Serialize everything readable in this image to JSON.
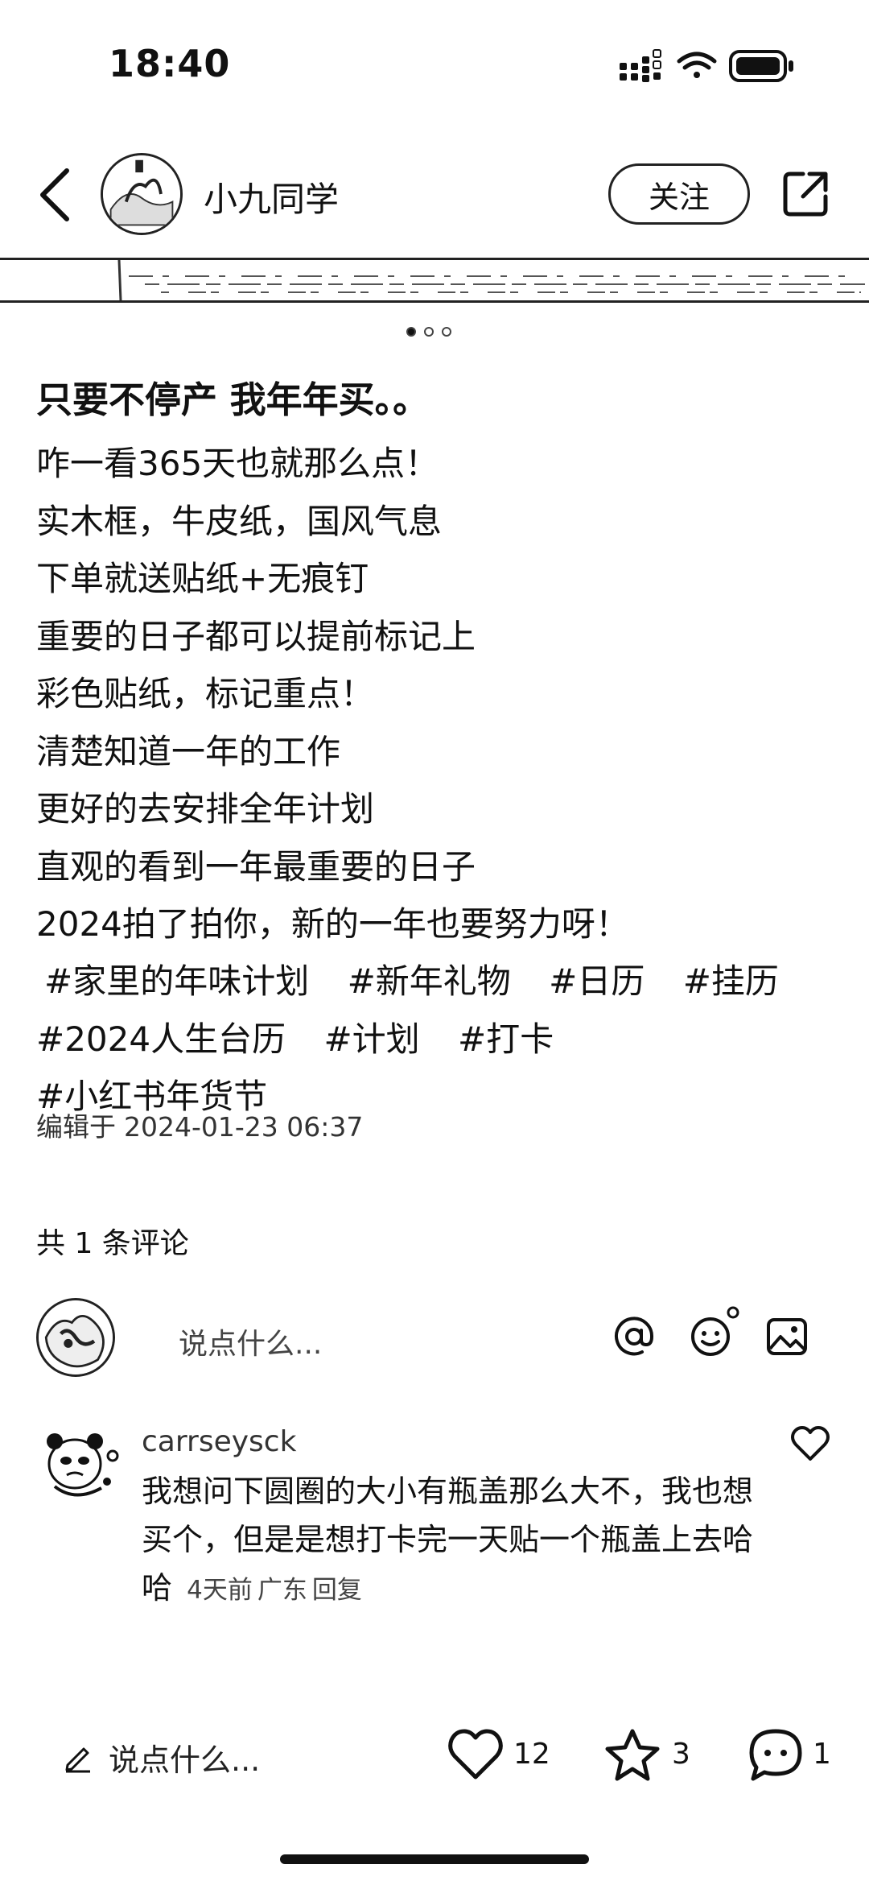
{
  "status": {
    "time": "18:40"
  },
  "header": {
    "author": "小九同学",
    "follow_label": "关注"
  },
  "post": {
    "title": "只要不停产 我年年买。。",
    "lines": [
      "咋一看365天也就那么点！",
      "实木框，牛皮纸，国风气息",
      "下单就送贴纸+无痕钉",
      "重要的日子都可以提前标记上",
      "彩色贴纸，标记重点！",
      "清楚知道一年的工作",
      "更好的去安排全年计划",
      "直观的看到一年最重要的日子",
      "2024拍了拍你，新的一年也要努力呀！"
    ],
    "tags_line1": [
      "#家里的年味计划",
      "#新年礼物",
      "#日历",
      "#挂历"
    ],
    "tags_line2": [
      "#2024人生台历",
      "#计划",
      "#打卡",
      "#小红书年货节"
    ],
    "edited_label": "编辑于",
    "edited_time": "2024-01-23 06:37",
    "slide_count": 3,
    "active_slide": 1
  },
  "comments": {
    "count_label": "共 1 条评论",
    "input_placeholder": "说点什么...",
    "items": [
      {
        "user": "carrseysck",
        "text": "我想问下圆圈的大小有瓶盖那么大不，我也想买个，但是是想打卡完一天贴一个瓶盖上去哈哈",
        "time": "4天前",
        "location": "广东",
        "reply_label": "回复"
      }
    ]
  },
  "bottom_bar": {
    "input_placeholder": "说点什么...",
    "likes": "12",
    "favorites": "3",
    "comments": "1"
  },
  "icons": [
    "back-icon",
    "share-icon",
    "at-icon",
    "emoji-icon",
    "image-icon",
    "heart-icon",
    "star-icon",
    "comment-icon",
    "pen-icon"
  ]
}
